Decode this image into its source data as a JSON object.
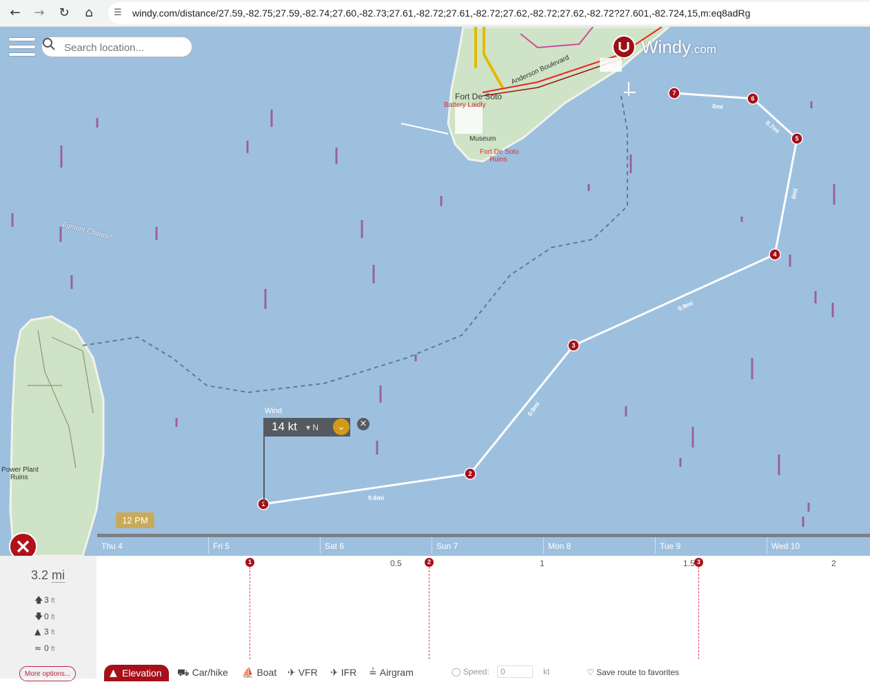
{
  "browser": {
    "url": "windy.com/distance/27.59,-82.75;27.59,-82.74;27.60,-82.73;27.61,-82.72;27.61,-82.72;27.62,-82.72;27.62,-82.72?27.601,-82.724,15,m:eq8adRg"
  },
  "search": {
    "placeholder": "Search location..."
  },
  "logo": {
    "name": "Windy",
    "suffix": ".com"
  },
  "map_labels": {
    "fort_de_soto": "Fort De Soto",
    "battery_laidly": "Battery Laidly",
    "anderson_blvd": "Anderson Boulevard",
    "museum": "Museum",
    "fort_ruins_1": "Fort De Soto",
    "fort_ruins_2": "Ruins",
    "egmont_channel": "Egmont Channel",
    "power_plant_1": "Power Plant",
    "power_plant_2": "Ruins"
  },
  "route": {
    "points": [
      "1",
      "2",
      "3",
      "4",
      "5",
      "6",
      "7"
    ],
    "segments": [
      "0.6mi",
      "0.9mi",
      "0.9mi",
      "0mi",
      "0.7mi",
      "0mi"
    ]
  },
  "wind": {
    "label": "Wind",
    "value": "14 kt",
    "direction": "N"
  },
  "time_badge": "12 PM",
  "days": [
    "Thu 4",
    "Fri 5",
    "Sat 6",
    "Sun 7",
    "Mon 8",
    "Tue 9",
    "Wed 10"
  ],
  "stats": {
    "distance_value": "3.2",
    "distance_unit": "mi",
    "ascent": "3",
    "descent": "0",
    "max_elevation": "3",
    "avg": "0",
    "unit": "ft"
  },
  "chart": {
    "axis_ticks": [
      "0.5",
      "1",
      "1.5",
      "2"
    ],
    "markers": [
      "1",
      "2",
      "3"
    ]
  },
  "more_options": "More options...",
  "tabs": {
    "elevation": "Elevation",
    "car": "Car/hike",
    "boat": "Boat",
    "vfr": "VFR",
    "ifr": "IFR",
    "airgram": "Airgram"
  },
  "speed": {
    "label": "Speed:",
    "value": "0",
    "unit": "kt"
  },
  "favorites": "Save route to favorites",
  "colors": {
    "sea": "#9ec0df",
    "land": "#cfe3c6",
    "route_marker": "#a5101a",
    "accent": "#d39a17"
  }
}
